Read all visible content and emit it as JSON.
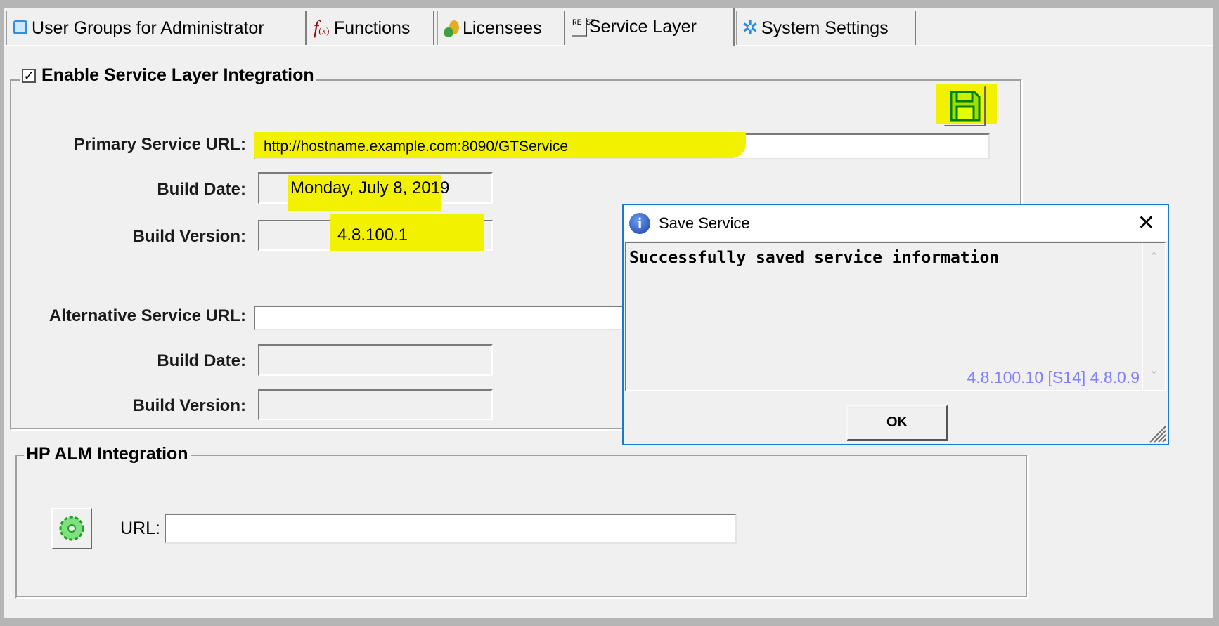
{
  "tabs": [
    {
      "label": "User Groups for Administrator",
      "icon": "monitor-icon"
    },
    {
      "label": "Functions",
      "icon": "function-icon"
    },
    {
      "label": "Licensees",
      "icon": "users-icon"
    },
    {
      "label": "Service Layer",
      "icon": "rest-icon",
      "icon_text": "RE ST",
      "active": true
    },
    {
      "label": "System Settings",
      "icon": "settings-arrows-icon"
    }
  ],
  "service_layer": {
    "enable_label": "Enable Service Layer Integration",
    "enabled": true,
    "primary_url_label": "Primary Service URL:",
    "primary_url_value": "http://hostname.example.com:8090/GTService",
    "build_date_label": "Build Date:",
    "build_date_value": "Monday, July 8, 2019",
    "build_version_label": "Build Version:",
    "build_version_value": "4.8.100.1",
    "alt_url_label": "Alternative Service URL:",
    "alt_url_value": "",
    "alt_build_date_label": "Build Date:",
    "alt_build_version_label": "Build Version:"
  },
  "hp_alm": {
    "title": "HP ALM Integration",
    "url_label": "URL:",
    "url_value": ""
  },
  "dialog": {
    "title": "Save Service",
    "message": "Successfully saved service information",
    "version": "4.8.100.10 [S14] 4.8.0.9",
    "ok_label": "OK"
  },
  "colors": {
    "highlight": "#f2f200",
    "dialog_border": "#1979ca",
    "version_text": "#8080ff"
  }
}
